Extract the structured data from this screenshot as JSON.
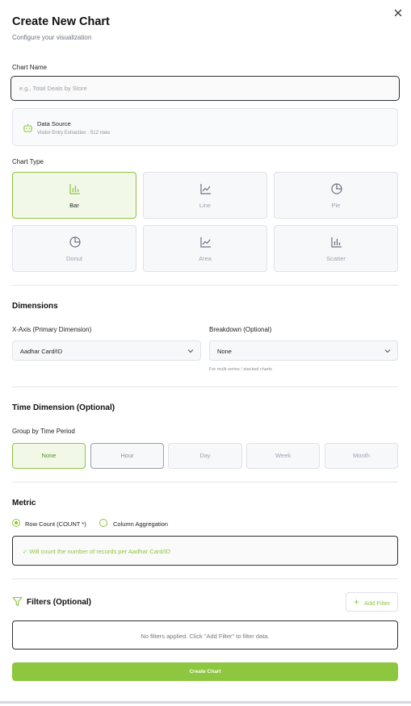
{
  "dialog": {
    "title": "Create New Chart",
    "subtitle": "Configure your visualization",
    "close_icon": "close-icon"
  },
  "chart_name": {
    "label": "Chart Name",
    "value": "",
    "placeholder": "e.g., Total Deals by Store"
  },
  "data_source": {
    "icon": "robot-icon",
    "title": "Data Source",
    "detail": "Visitor Entry Extraction · 512 rows"
  },
  "chart_type": {
    "label": "Chart Type",
    "selected": "Bar",
    "options": [
      {
        "label": "Bar",
        "icon": "bar-chart-icon"
      },
      {
        "label": "Line",
        "icon": "line-chart-icon"
      },
      {
        "label": "Pie",
        "icon": "pie-chart-icon"
      },
      {
        "label": "Donut",
        "icon": "donut-chart-icon"
      },
      {
        "label": "Area",
        "icon": "area-chart-icon"
      },
      {
        "label": "Scatter",
        "icon": "scatter-chart-icon"
      }
    ]
  },
  "dimensions": {
    "heading": "Dimensions",
    "x_axis_label": "X-Axis (Primary Dimension)",
    "x_axis_value": "Aadhar Card/ID",
    "breakdown_label": "Breakdown (Optional)",
    "breakdown_value": "None",
    "breakdown_hint": "For multi-series / stacked charts"
  },
  "time_dimension": {
    "heading": "Time Dimension (Optional)",
    "group_label": "Group by Time Period",
    "selected": "None",
    "options": [
      "None",
      "Hour",
      "Day",
      "Week",
      "Month"
    ]
  },
  "metric": {
    "heading": "Metric",
    "option_row_count": "Row Count (COUNT *)",
    "option_column_agg": "Column Aggregation",
    "selected": "Row Count (COUNT *)",
    "info": "✓ Will count the number of records per Aadhar Card/ID"
  },
  "filters": {
    "heading": "Filters (Optional)",
    "icon": "filter-icon",
    "add_label": "Add Filter",
    "empty_text": "No filters applied. Click \"Add Filter\" to filter data."
  },
  "footer": {
    "create_label": "Create Chart"
  },
  "colors": {
    "accent": "#8dc63f",
    "selected_bg": "#f1f8e7",
    "border": "#dfe2e6"
  }
}
